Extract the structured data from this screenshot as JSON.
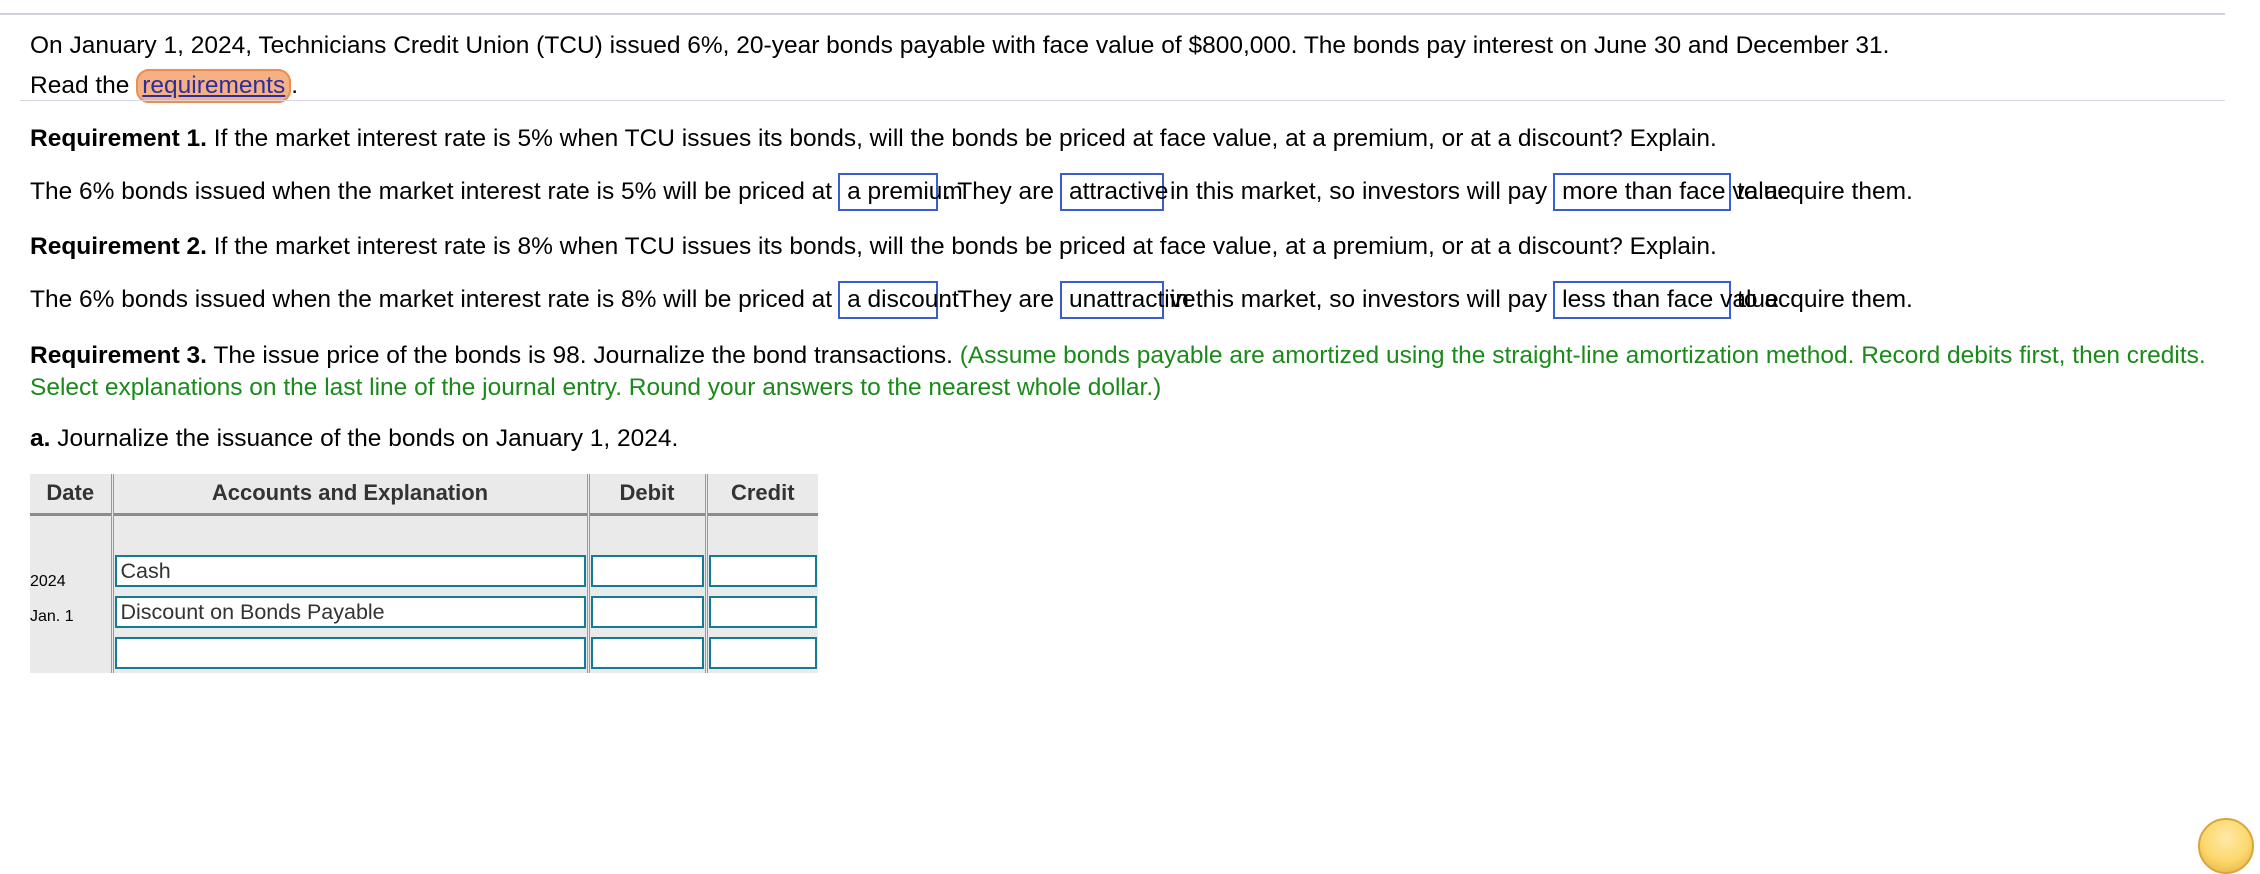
{
  "intro": {
    "paragraph": "On January 1, 2024, Technicians Credit Union (TCU) issued 6%, 20-year bonds payable with face value of $800,000. The bonds pay interest on June 30 and December 31.",
    "read_prefix": "Read the ",
    "read_link": "requirements",
    "read_suffix": "."
  },
  "requirement1": {
    "label": "Requirement 1.",
    "question": " If the market interest rate is 5% when TCU issues its bonds, will the bonds be priced at face value, at a premium, or at a discount? Explain.",
    "answer": {
      "seg1": "The 6% bonds issued when the market interest rate is 5% will be priced at",
      "blank1": "a premium",
      "seg2": ". They are",
      "blank2": "attractive",
      "seg3": "in this market, so investors will pay",
      "blank3": "more than face value",
      "seg4": "to acquire them."
    }
  },
  "requirement2": {
    "label": "Requirement 2.",
    "question": " If the market interest rate is 8% when TCU issues its bonds, will the bonds be priced at face value, at a premium, or at a discount? Explain.",
    "answer": {
      "seg1": "The 6% bonds issued when the market interest rate is 8% will be priced at",
      "blank1": "a discount",
      "seg2": ". They are",
      "blank2": "unattractive",
      "seg3": "in this market, so investors will pay",
      "blank3": "less than face value",
      "seg4": "to acquire them."
    }
  },
  "requirement3": {
    "label": "Requirement 3.",
    "question": " The issue price of the bonds is 98. Journalize the bond transactions. ",
    "note": "(Assume bonds payable are amortized using the straight-line amortization method. Record debits first, then credits. Select explanations on the last line of the journal entry. Round your answers to the nearest whole dollar.)",
    "part_a_label": "a.",
    "part_a_text": " Journalize the issuance of the bonds on January 1, 2024."
  },
  "journal": {
    "headers": {
      "date": "Date",
      "accounts": "Accounts and Explanation",
      "debit": "Debit",
      "credit": "Credit"
    },
    "date_year": "2024",
    "date_day": "Jan. 1",
    "rows": [
      {
        "account": "Cash",
        "debit": "",
        "credit": ""
      },
      {
        "account": "Discount on Bonds Payable",
        "debit": "",
        "credit": ""
      },
      {
        "account": "",
        "debit": "",
        "credit": ""
      }
    ]
  },
  "colors": {
    "blank_border": "#3a5fcd",
    "note_green": "#1a8a1a",
    "link_highlight": "#f5b183",
    "input_border": "#147b96"
  }
}
